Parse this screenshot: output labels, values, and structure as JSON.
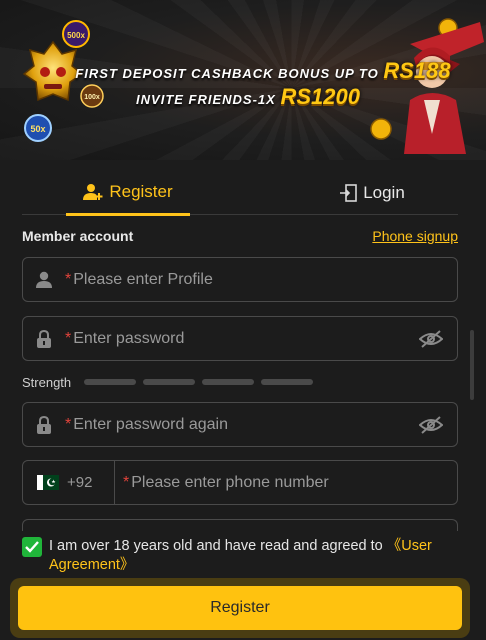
{
  "banner": {
    "line1_text": "FIRST DEPOSIT CASHBACK BONUS UP TO",
    "line1_amount": "RS188",
    "line2_text": "INVITE FRIENDS-1X",
    "line2_amount": "RS1200",
    "chip_500": "500x",
    "chip_100": "100x",
    "chip_50": "50x"
  },
  "tabs": {
    "register_label": "Register",
    "login_label": "Login"
  },
  "form": {
    "member_account_label": "Member account",
    "phone_signup_link": "Phone signup",
    "profile_placeholder": "Please enter Profile",
    "password_placeholder": "Enter password",
    "strength_label": "Strength",
    "password_again_placeholder": "Enter password again",
    "dial_code": "+92",
    "phone_placeholder": "Please enter phone number",
    "required_mark": "*"
  },
  "agreement": {
    "text": "I am over 18 years old and have read and agreed to",
    "link": "《User Agreement》",
    "checked": true
  },
  "submit": {
    "label": "Register"
  },
  "colors": {
    "accent": "#ffc31a",
    "check": "#20b53a",
    "required": "#e0433b"
  }
}
